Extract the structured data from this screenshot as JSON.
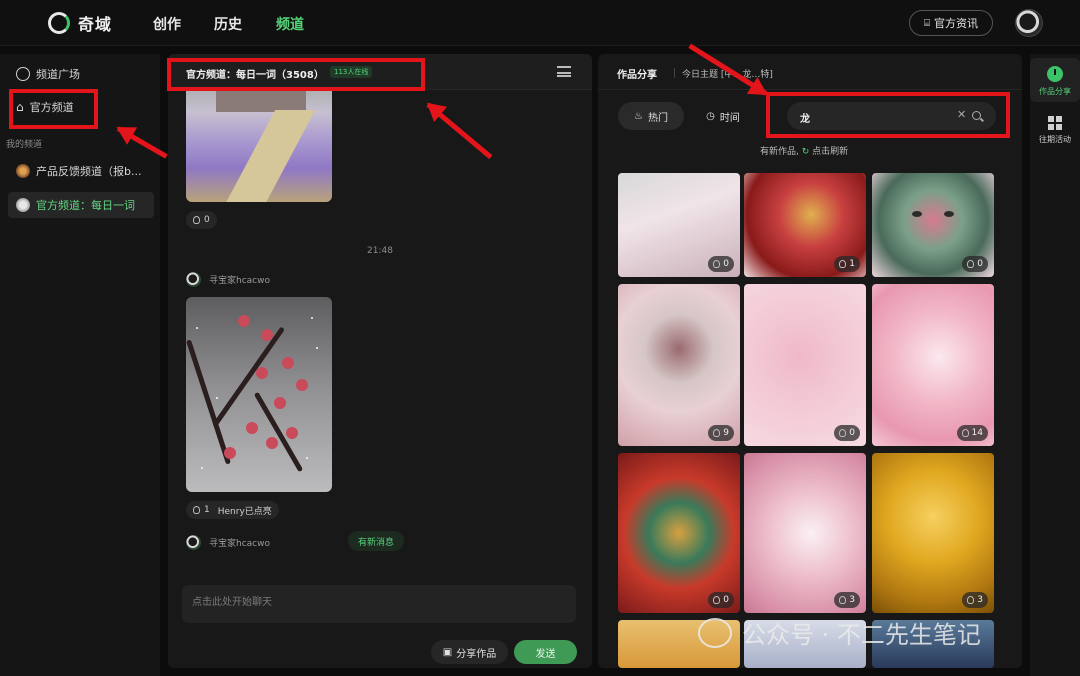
{
  "topbar": {
    "logo_text": "奇域",
    "nav": [
      "创作",
      "历史",
      "频道"
    ],
    "news_button": "官方资讯"
  },
  "sidebar": {
    "items": [
      {
        "label": "频道广场"
      },
      {
        "label": "官方频道"
      }
    ],
    "section_label": "我的频道",
    "my_channels": [
      {
        "label": "产品反馈频道（报b..."
      },
      {
        "label": "官方频道：每日一词"
      }
    ]
  },
  "chat": {
    "title": "官方频道：每日一词（3508）",
    "online": "113人在线",
    "msg1_likes": "0",
    "timestamp": "21:48",
    "sender1": "寻宝家hcacwo",
    "msg2_likes": "1",
    "msg2_liked_by": "Henry已点亮",
    "sender2": "寻宝家hcacwo",
    "new_message": "有新消息",
    "input_placeholder": "点击此处开始聊天",
    "share_button": "分享作品",
    "send_button": "发送"
  },
  "gallery": {
    "title": "作品分享",
    "theme": "今日主题 [中…龙…特]",
    "tab_hot": "热门",
    "tab_time": "时间",
    "search_value": "龙",
    "refresh_prefix": "有新作品,",
    "refresh_link": "点击刷新",
    "tiles": [
      {
        "likes": "0"
      },
      {
        "likes": "1"
      },
      {
        "likes": "0"
      },
      {
        "likes": "9"
      },
      {
        "likes": "0"
      },
      {
        "likes": "14"
      },
      {
        "likes": "0"
      },
      {
        "likes": "3"
      },
      {
        "likes": "3"
      }
    ]
  },
  "rail": {
    "items": [
      {
        "label": "作品分享"
      },
      {
        "label": "往期活动"
      }
    ]
  },
  "watermark": {
    "text": "公众号 · 不二先生笔记"
  },
  "colors": {
    "accent": "#56d47a",
    "highlight": "#e3151a",
    "background": "#0c0c0c"
  }
}
